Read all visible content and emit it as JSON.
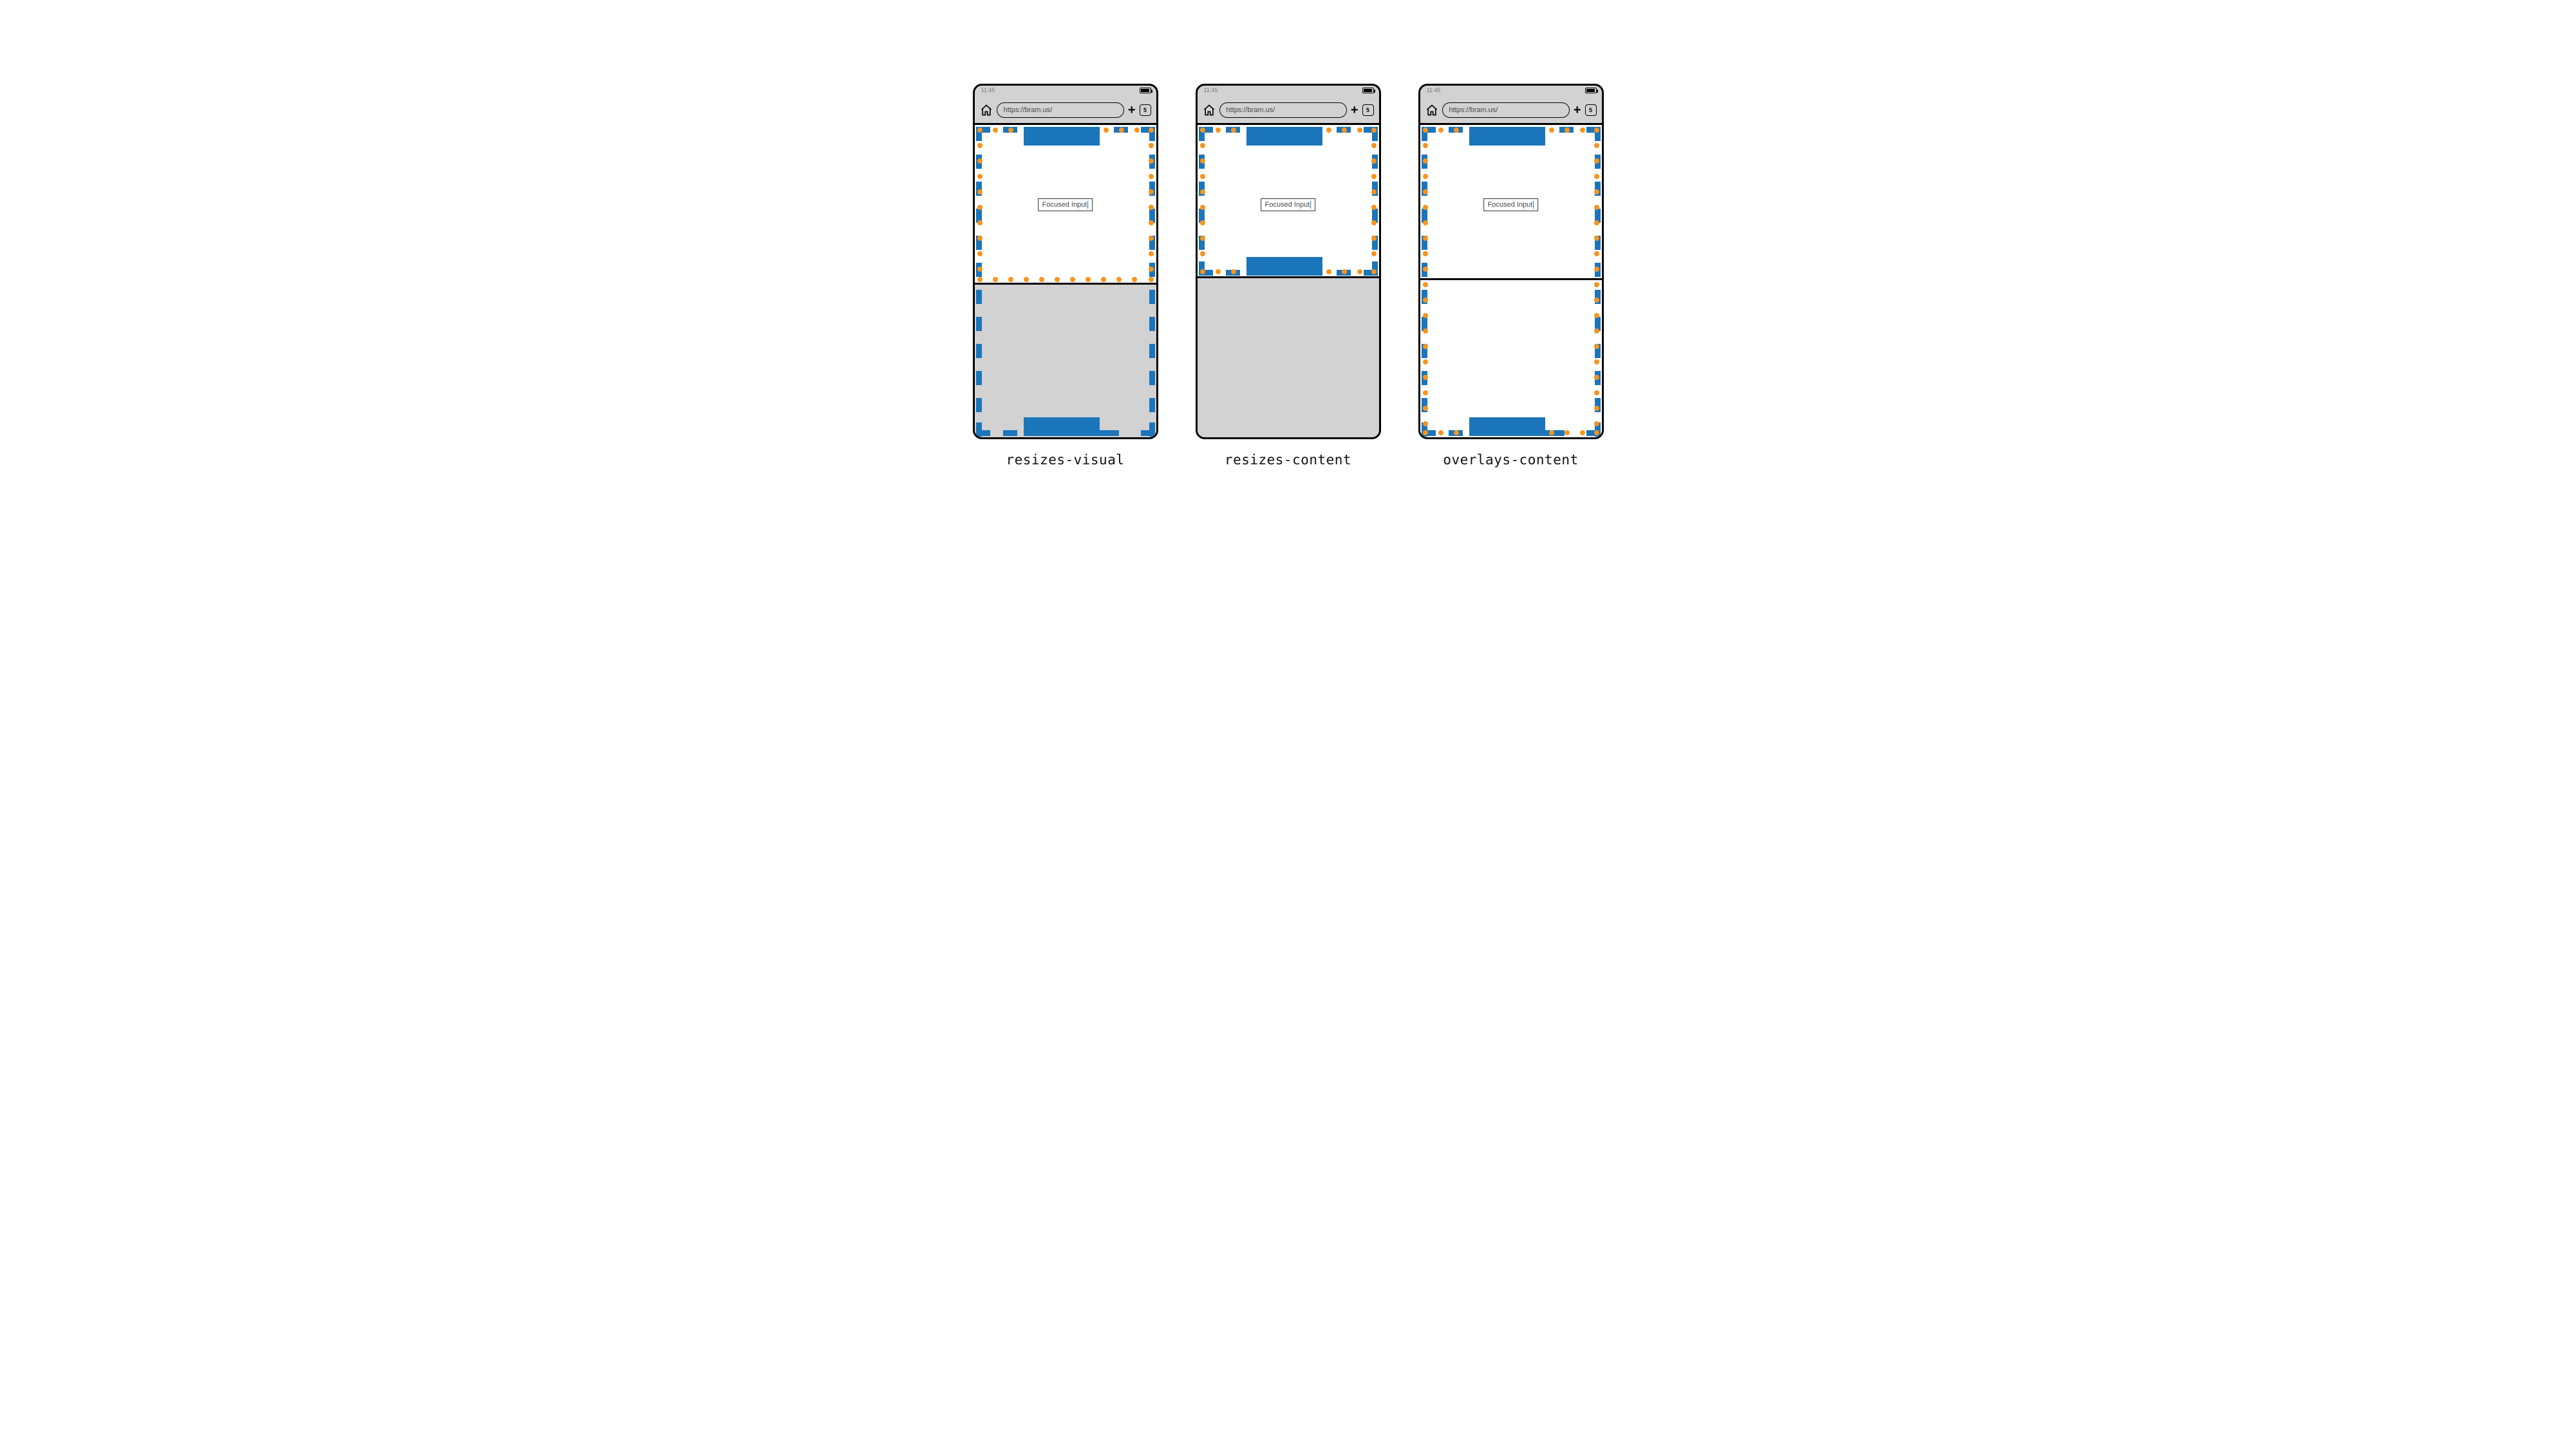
{
  "status": {
    "time": "11:45"
  },
  "toolbar": {
    "url": "https://bram.us/",
    "tab_count": "5"
  },
  "input": {
    "value": "Focused Input"
  },
  "captions": {
    "a": "resizes-visual",
    "b": "resizes-content",
    "c": "overlays-content"
  },
  "colors": {
    "accent": "#1b75bb",
    "dots": "#f7941d"
  }
}
